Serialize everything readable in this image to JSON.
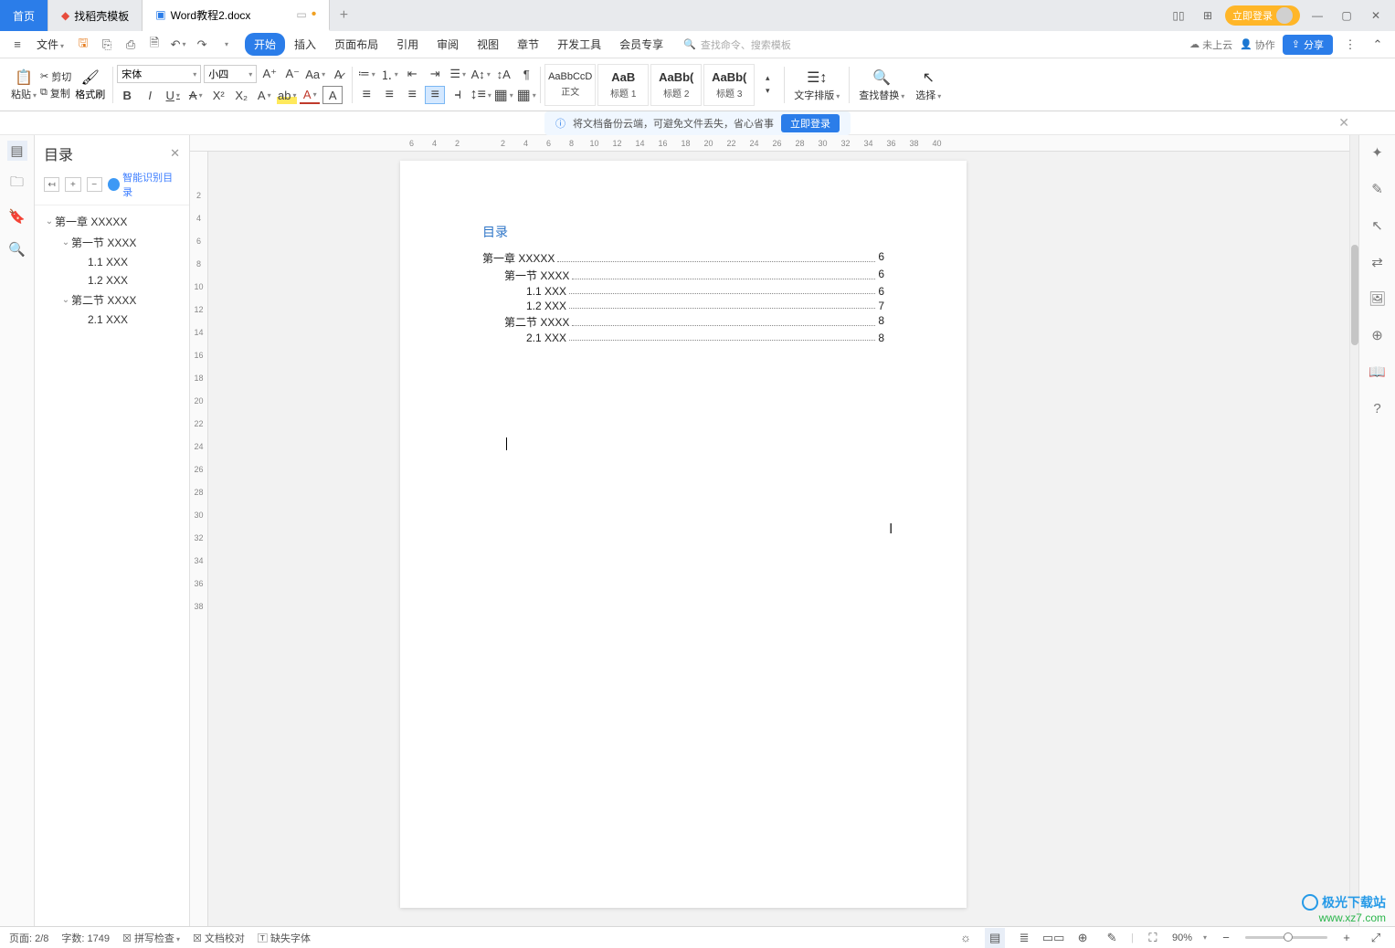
{
  "tabs": {
    "home": "首页",
    "template": "找稻壳模板",
    "active": "Word教程2.docx"
  },
  "window": {
    "login": "立即登录"
  },
  "menu": {
    "file": "文件",
    "items": [
      "开始",
      "插入",
      "页面布局",
      "引用",
      "审阅",
      "视图",
      "章节",
      "开发工具",
      "会员专享"
    ],
    "search_placeholder": "查找命令、搜索模板",
    "notcloud": "未上云",
    "collab": "协作",
    "share": "分享"
  },
  "ribbon": {
    "paste": "粘贴",
    "cut": "剪切",
    "copy": "复制",
    "fmtpainter": "格式刷",
    "font_name": "宋体",
    "font_size": "小四",
    "styles": [
      {
        "preview": "AaBbCcD",
        "name": "正文"
      },
      {
        "preview": "AaB",
        "name": "标题 1"
      },
      {
        "preview": "AaBb(",
        "name": "标题 2"
      },
      {
        "preview": "AaBb(",
        "name": "标题 3"
      }
    ],
    "textlayout": "文字排版",
    "findreplace": "查找替换",
    "select": "选择"
  },
  "notify": {
    "text": "将文档备份云端，可避免文件丢失，省心省事",
    "login": "立即登录"
  },
  "toc": {
    "title": "目录",
    "smart": "智能识别目录",
    "items": [
      {
        "level": 0,
        "text": "第一章  XXXXX"
      },
      {
        "level": 1,
        "text": "第一节  XXXX"
      },
      {
        "level": 2,
        "text": "1.1 XXX"
      },
      {
        "level": 2,
        "text": "1.2 XXX"
      },
      {
        "level": 1,
        "text": "第二节  XXXX"
      },
      {
        "level": 2,
        "text": "2.1 XXX"
      }
    ]
  },
  "hruler": [
    "6",
    "4",
    "2",
    "",
    "2",
    "4",
    "6",
    "8",
    "10",
    "12",
    "14",
    "16",
    "18",
    "20",
    "22",
    "24",
    "26",
    "28",
    "30",
    "32",
    "34",
    "36",
    "38",
    "40"
  ],
  "vruler": [
    "",
    "2",
    "4",
    "6",
    "8",
    "10",
    "12",
    "14",
    "16",
    "18",
    "20",
    "22",
    "24",
    "26",
    "28",
    "30",
    "32",
    "34",
    "36",
    "38"
  ],
  "document": {
    "toc_heading": "目录",
    "lines": [
      {
        "indent": 0,
        "text": "第一章  XXXXX",
        "page": "6"
      },
      {
        "indent": 1,
        "text": "第一节  XXXX",
        "page": "6"
      },
      {
        "indent": 2,
        "text": "1.1 XXX",
        "page": "6"
      },
      {
        "indent": 2,
        "text": "1.2 XXX",
        "page": "7"
      },
      {
        "indent": 1,
        "text": "第二节  XXXX",
        "page": "8"
      },
      {
        "indent": 2,
        "text": "2.1 XXX",
        "page": "8"
      }
    ]
  },
  "status": {
    "page": "页面: 2/8",
    "words": "字数: 1749",
    "spell": "拼写检查",
    "proof": "文档校对",
    "fonts": "缺失字体",
    "zoom": "90%"
  },
  "watermark": {
    "brand": "极光下载站",
    "url": "www.xz7.com"
  }
}
